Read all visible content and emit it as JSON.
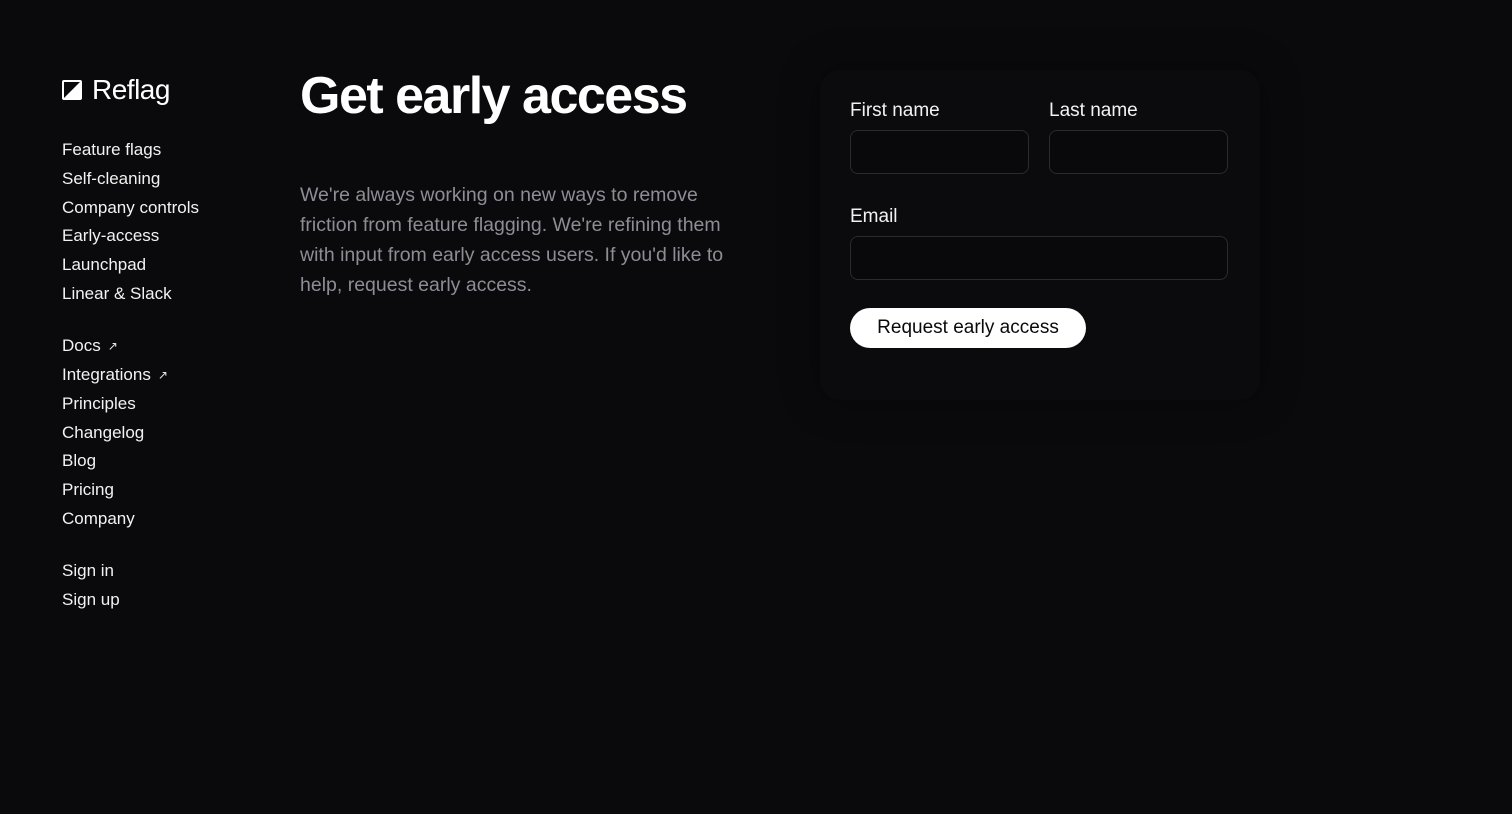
{
  "brand": {
    "name": "Reflag",
    "logo_icon": "half-square-logo-icon"
  },
  "nav": {
    "product": [
      {
        "label": "Feature flags"
      },
      {
        "label": "Self-cleaning"
      },
      {
        "label": "Company controls"
      },
      {
        "label": "Early-access"
      },
      {
        "label": "Launchpad"
      },
      {
        "label": "Linear & Slack"
      }
    ],
    "resources": [
      {
        "label": "Docs",
        "external": true
      },
      {
        "label": "Integrations",
        "external": true
      },
      {
        "label": "Principles"
      },
      {
        "label": "Changelog"
      },
      {
        "label": "Blog"
      },
      {
        "label": "Pricing"
      },
      {
        "label": "Company"
      }
    ],
    "account": [
      {
        "label": "Sign in"
      },
      {
        "label": "Sign up"
      }
    ],
    "external_icon": "↗"
  },
  "main": {
    "title": "Get early access",
    "description": "We're always working on new ways to remove friction from feature flagging. We're refining them with input from early access users. If you'd like to help, request early access."
  },
  "form": {
    "first_name_label": "First name",
    "first_name_value": "",
    "last_name_label": "Last name",
    "last_name_value": "",
    "email_label": "Email",
    "email_value": "",
    "submit_label": "Request early access"
  },
  "colors": {
    "background": "#0a0a0c",
    "text": "#ffffff",
    "muted_text": "#8d8d96",
    "input_border": "#2a2a30",
    "button_bg": "#ffffff",
    "button_text": "#0a0a0c"
  }
}
